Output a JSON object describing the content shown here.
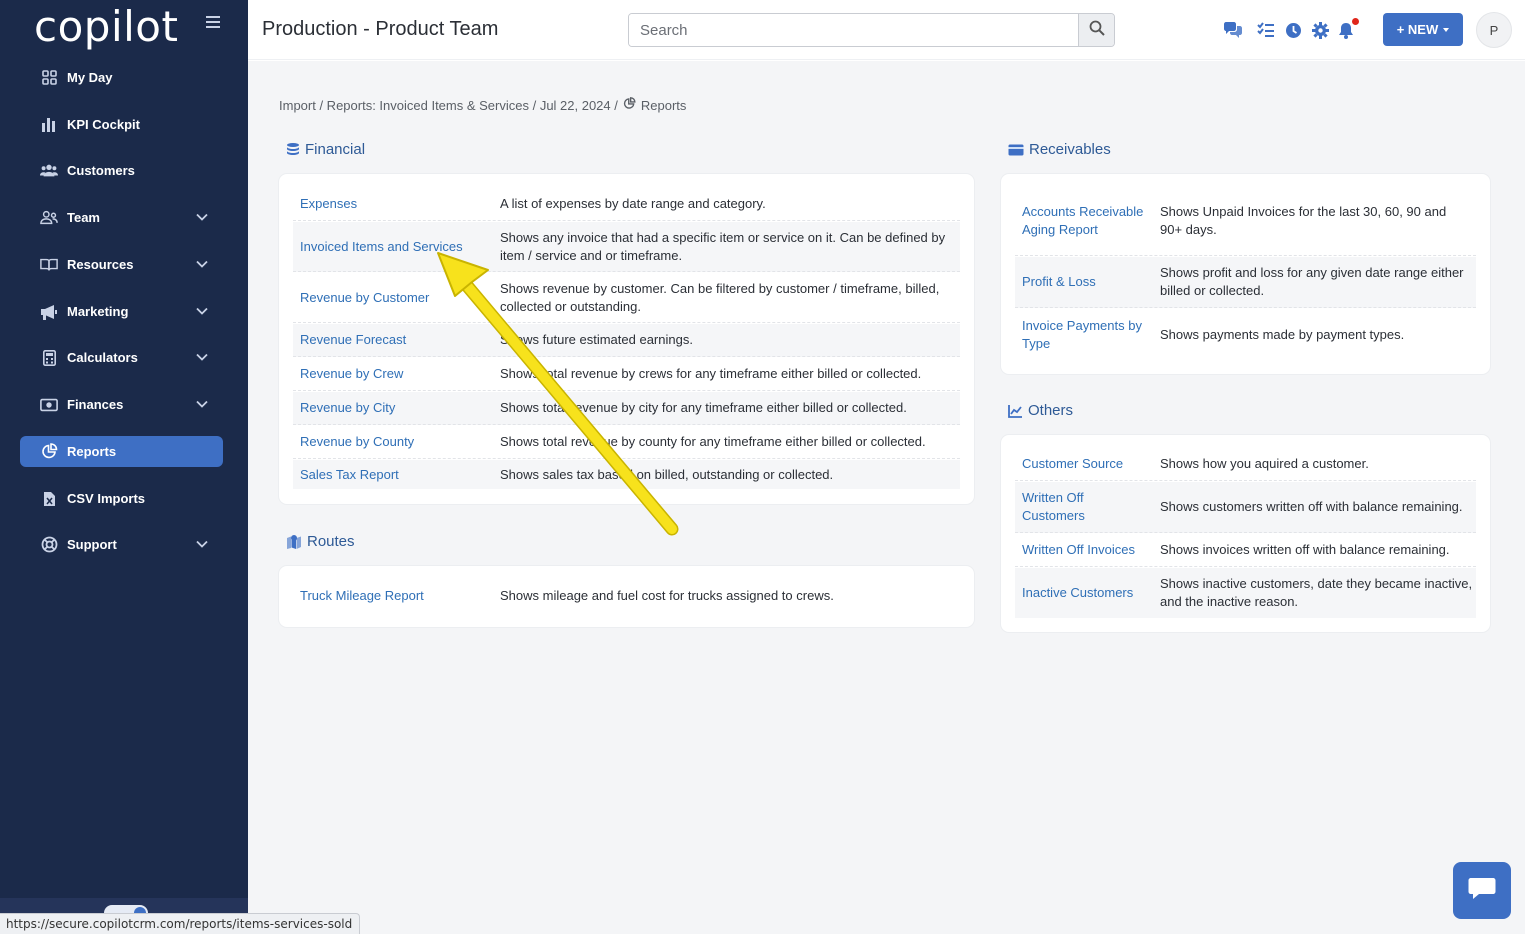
{
  "sidebar": {
    "logo": "copilot",
    "items": [
      {
        "label": "My Day",
        "icon": "grid-icon",
        "expandable": false,
        "active": false
      },
      {
        "label": "KPI Cockpit",
        "icon": "bar-chart-icon",
        "expandable": false,
        "active": false
      },
      {
        "label": "Customers",
        "icon": "users-icon",
        "expandable": false,
        "active": false
      },
      {
        "label": "Team",
        "icon": "team-icon",
        "expandable": true,
        "active": false
      },
      {
        "label": "Resources",
        "icon": "book-icon",
        "expandable": true,
        "active": false
      },
      {
        "label": "Marketing",
        "icon": "megaphone-icon",
        "expandable": true,
        "active": false
      },
      {
        "label": "Calculators",
        "icon": "calculator-icon",
        "expandable": true,
        "active": false
      },
      {
        "label": "Finances",
        "icon": "money-icon",
        "expandable": true,
        "active": false
      },
      {
        "label": "Reports",
        "icon": "pie-chart-icon",
        "expandable": false,
        "active": true
      },
      {
        "label": "CSV Imports",
        "icon": "csv-file-icon",
        "expandable": false,
        "active": false
      },
      {
        "label": "Support",
        "icon": "lifebuoy-icon",
        "expandable": true,
        "active": false
      }
    ]
  },
  "header": {
    "title": "Production - Product Team",
    "search_placeholder": "Search",
    "new_label": "+ NEW",
    "avatar_initial": "P"
  },
  "breadcrumb": {
    "path": "Import / Reports: Invoiced Items & Services / Jul 22, 2024 /",
    "current": "Reports"
  },
  "sections": {
    "financial": {
      "title": "Financial",
      "rows": [
        {
          "link": "Expenses",
          "desc": "A list of expenses by date range and category."
        },
        {
          "link": "Invoiced Items and Services",
          "desc": "Shows any invoice that had a specific item or service on it. Can be defined by item / service and or timeframe."
        },
        {
          "link": "Revenue by Customer",
          "desc": "Shows revenue by customer. Can be filtered by customer / timeframe, billed, collected or outstanding."
        },
        {
          "link": "Revenue Forecast",
          "desc": "Shows future estimated earnings."
        },
        {
          "link": "Revenue by Crew",
          "desc": "Shows total revenue by crews for any timeframe either billed or collected."
        },
        {
          "link": "Revenue by City",
          "desc": "Shows total revenue by city for any timeframe either billed or collected."
        },
        {
          "link": "Revenue by County",
          "desc": "Shows total revenue by county for any timeframe either billed or collected."
        },
        {
          "link": "Sales Tax Report",
          "desc": "Shows sales tax based on billed, outstanding or collected."
        }
      ]
    },
    "routes": {
      "title": "Routes",
      "rows": [
        {
          "link": "Truck Mileage Report",
          "desc": "Shows mileage and fuel cost for trucks assigned to crews."
        }
      ]
    },
    "receivables": {
      "title": "Receivables",
      "rows": [
        {
          "link": "Accounts Receivable Aging Report",
          "desc": "Shows Unpaid Invoices for the last 30, 60, 90 and 90+ days."
        },
        {
          "link": "Profit & Loss",
          "desc": "Shows profit and loss for any given date range either billed or collected."
        },
        {
          "link": "Invoice Payments by Type",
          "desc": "Shows payments made by payment types."
        }
      ]
    },
    "others": {
      "title": "Others",
      "rows": [
        {
          "link": "Customer Source",
          "desc": "Shows how you aquired a customer."
        },
        {
          "link": "Written Off Customers",
          "desc": "Shows customers written off with balance remaining."
        },
        {
          "link": "Written Off Invoices",
          "desc": "Shows invoices written off with balance remaining."
        },
        {
          "link": "Inactive Customers",
          "desc": "Shows inactive customers, date they became inactive, and the inactive reason."
        }
      ]
    }
  },
  "status_url": "https://secure.copilotcrm.com/reports/items-services-sold",
  "colors": {
    "sidebar_bg": "#1b2a4a",
    "accent": "#3e6fc4",
    "link": "#2f6fb6",
    "annotation_arrow": "#f7e21c"
  }
}
